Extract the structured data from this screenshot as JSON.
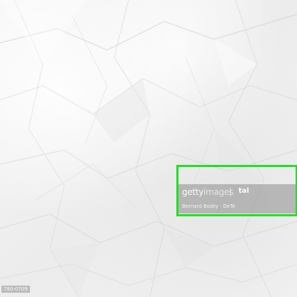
{
  "image": {
    "subject": "crumpled white paper texture"
  },
  "watermark": {
    "logo_text_a": "getty",
    "logo_text_b": "images",
    "id_text": "tal",
    "credit": "Bernard Bosky · DeTe"
  },
  "corner_label": "780-0709",
  "highlight": {
    "color": "#22e022"
  }
}
